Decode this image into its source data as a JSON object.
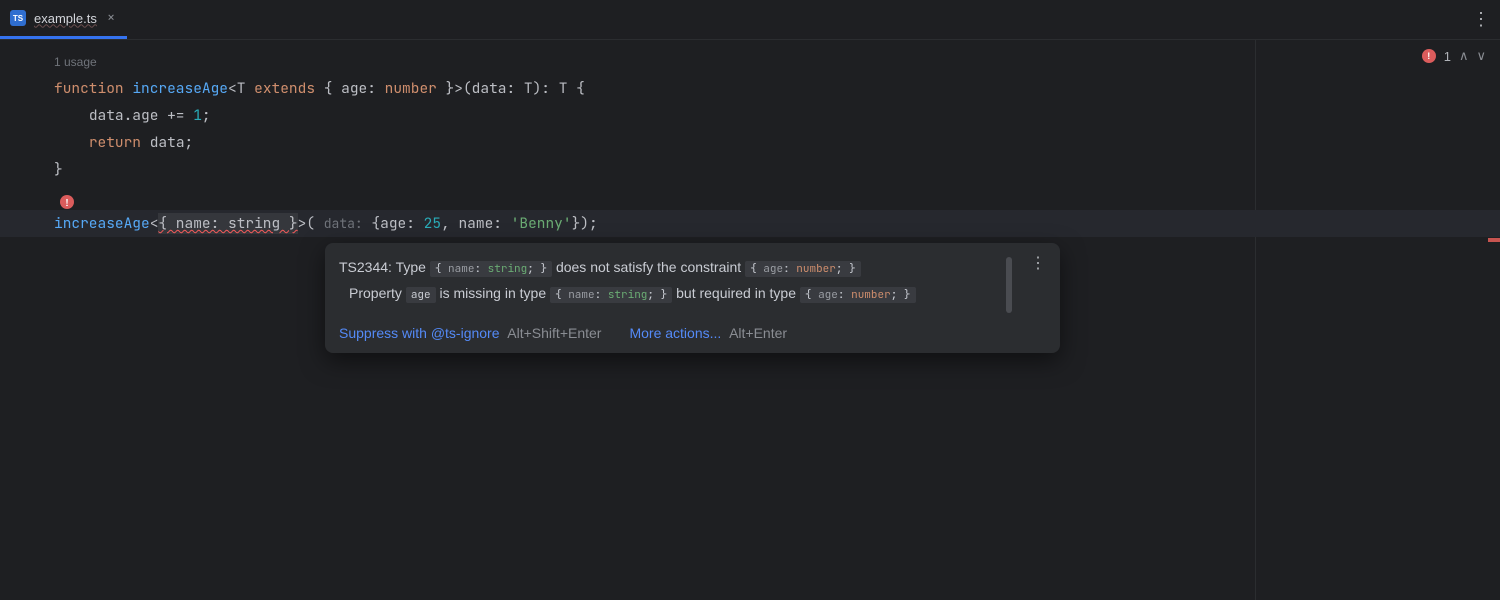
{
  "tab": {
    "icon_text": "TS",
    "filename": "example.ts"
  },
  "editor": {
    "usage_hint": "1 usage",
    "kw_function": "function",
    "fn_name": "increaseAge",
    "kw_extends": "extends",
    "type_age": "age",
    "type_number": "number",
    "param_data": "data",
    "generic_T": "T",
    "body_line1_a": "data.age += ",
    "body_line1_num": "1",
    "body_line1_b": ";",
    "kw_return": "return",
    "body_line2": " data;",
    "call_err": "{ name: string }",
    "hint_data": "data:",
    "obj_age_key": "age",
    "obj_age_val": "25",
    "obj_name_key": "name",
    "obj_name_val": "'Benny'"
  },
  "tooltip": {
    "err_code": "TS2344",
    "msg1a": ": Type ",
    "chip1_name": "name",
    "chip1_string": "string",
    "msg1b": " does not satisfy the constraint ",
    "chip2_age": "age",
    "chip2_number": "number",
    "msg2a": "Property ",
    "chip3": "age",
    "msg2b": " is missing in type ",
    "chip4_name": "name",
    "chip4_string": "string",
    "msg2c": " but required in type ",
    "chip5_age": "age",
    "chip5_number": "number",
    "action1": "Suppress with @ts-ignore",
    "shortcut1": "Alt+Shift+Enter",
    "action2": "More actions...",
    "shortcut2": "Alt+Enter"
  },
  "inspections": {
    "error_count": "1"
  }
}
